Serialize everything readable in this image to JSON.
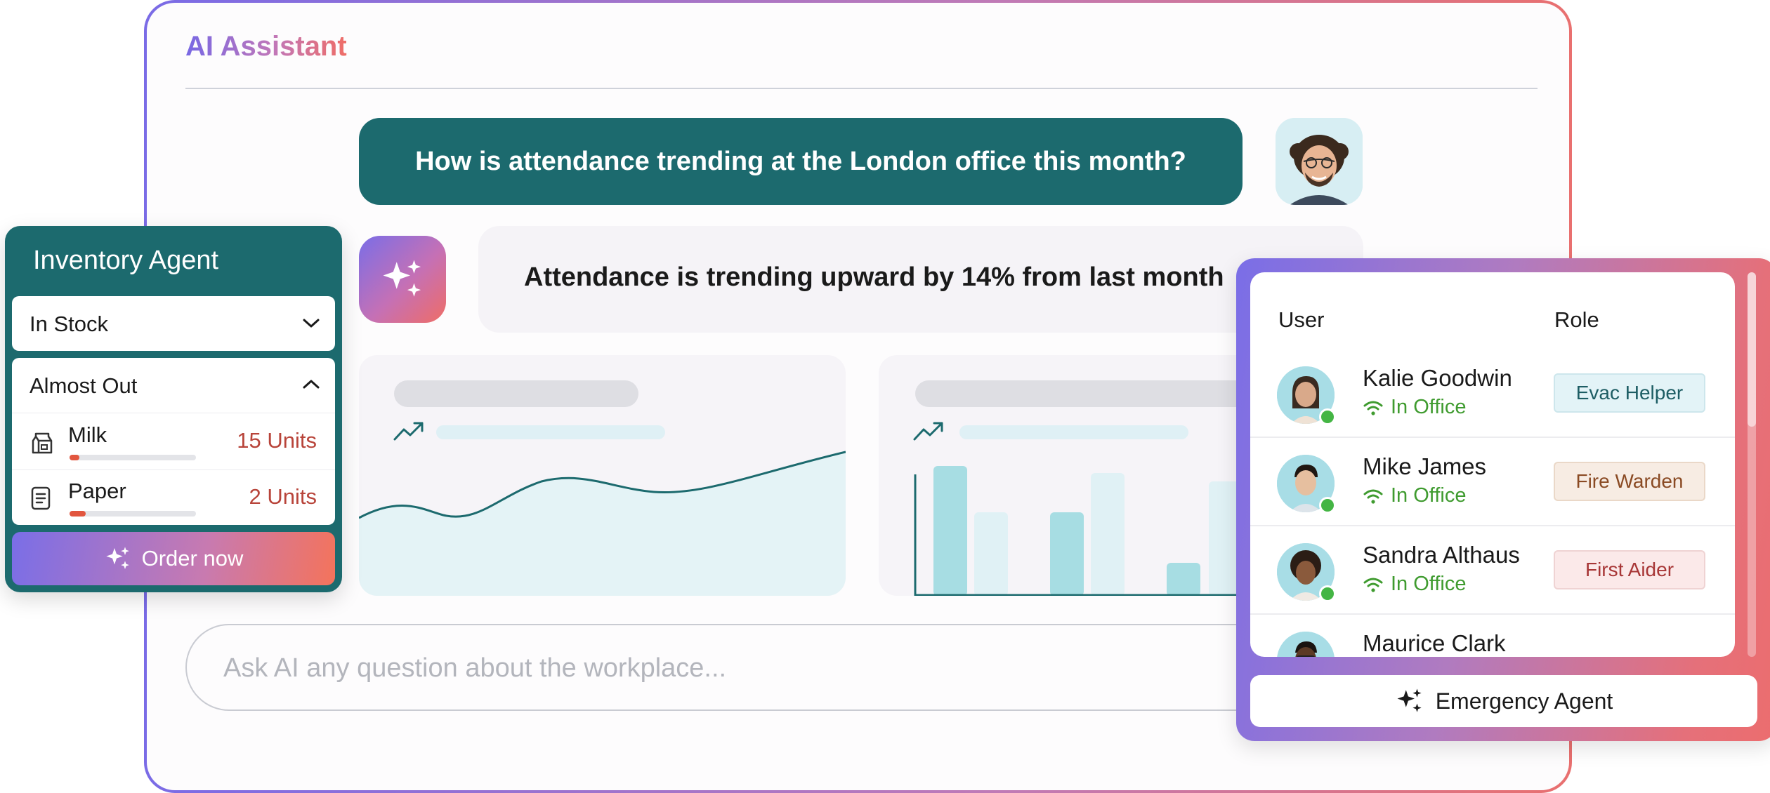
{
  "app": {
    "title": "AI Assistant"
  },
  "chat": {
    "user_message": "How is attendance trending at the London office this month?",
    "ai_message": "Attendance is trending upward by 14% from last month"
  },
  "prompt": {
    "placeholder": "Ask AI any question about the workplace..."
  },
  "inventory_agent": {
    "title": "Inventory Agent",
    "sections": [
      {
        "label": "In Stock",
        "expanded": false
      },
      {
        "label": "Almost Out",
        "expanded": true
      }
    ],
    "items": [
      {
        "name": "Milk",
        "count": "15 Units",
        "level": 0.08,
        "icon": "milk-carton-icon"
      },
      {
        "name": "Paper",
        "count": "2 Units",
        "level": 0.13,
        "icon": "document-icon"
      }
    ],
    "order_button": "Order now"
  },
  "emergency_agent": {
    "columns": {
      "user": "User",
      "role": "Role"
    },
    "users": [
      {
        "name": "Kalie Goodwin",
        "status": "In Office",
        "role": "Evac Helper",
        "role_style": "evac"
      },
      {
        "name": "Mike James",
        "status": "In Office",
        "role": "Fire Warden",
        "role_style": "fire"
      },
      {
        "name": "Sandra Althaus",
        "status": "In Office",
        "role": "First Aider",
        "role_style": "first"
      },
      {
        "name": "Maurice Clark",
        "status": "",
        "role": "",
        "role_style": ""
      }
    ],
    "button": "Emergency Agent"
  },
  "colors": {
    "brand_teal": "#1c6a6e",
    "gradient_start": "#7a6ee7",
    "gradient_end": "#ec6d6e",
    "online_green": "#44b544",
    "alert_red": "#b8443a"
  }
}
